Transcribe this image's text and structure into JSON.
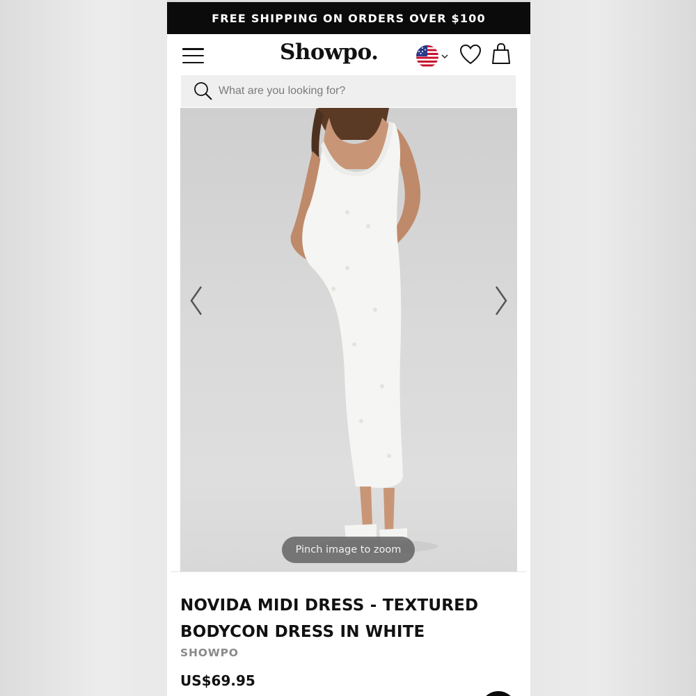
{
  "promo": {
    "text": "FREE SHIPPING ON ORDERS OVER $100"
  },
  "header": {
    "logo": "Showpo.",
    "menu_icon": "hamburger-menu-icon",
    "region_icon": "us-flag-icon",
    "wishlist_icon": "heart-icon",
    "cart_icon": "shopping-bag-icon"
  },
  "search": {
    "placeholder": "What are you looking for?",
    "icon": "search-icon"
  },
  "gallery": {
    "prev_icon": "chevron-left-icon",
    "next_icon": "chevron-right-icon",
    "zoom_hint": "Pinch image to zoom"
  },
  "product": {
    "title_line1": "NOVIDA MIDI DRESS - TEXTURED",
    "title_line2": "BODYCON DRESS IN WHITE",
    "brand": "SHOWPO",
    "price": "US$69.95"
  },
  "colors": {
    "promo_bg": "#0b0b0b",
    "text": "#111111",
    "brand_gray": "#8a8a8a",
    "search_bg": "#efefef"
  }
}
